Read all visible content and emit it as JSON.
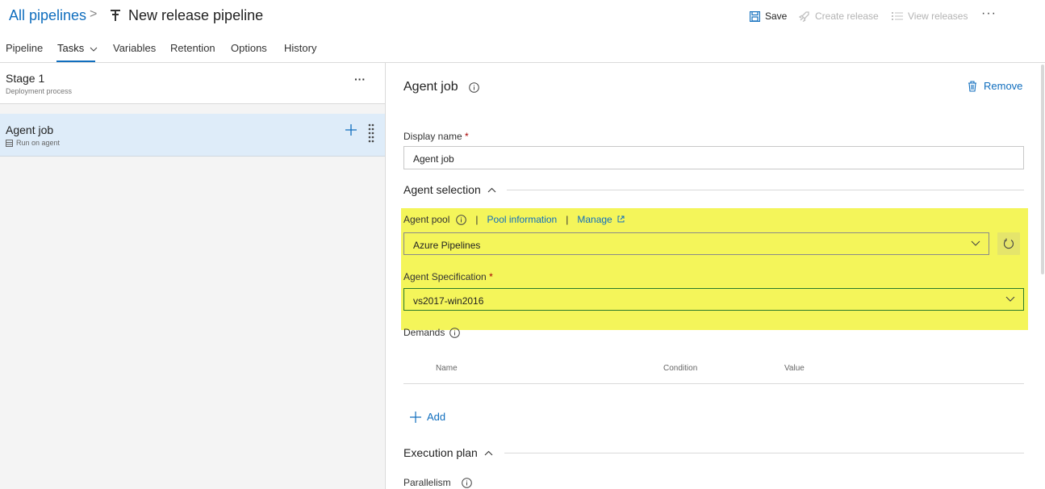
{
  "header": {
    "breadcrumb_root": "All pipelines",
    "breadcrumb_sep": ">",
    "title": "New release pipeline",
    "actions": {
      "save": "Save",
      "create_release": "Create release",
      "view_releases": "View releases",
      "more": "···"
    }
  },
  "tabs": [
    {
      "label": "Pipeline"
    },
    {
      "label": "Tasks",
      "active": true
    },
    {
      "label": "Variables"
    },
    {
      "label": "Retention"
    },
    {
      "label": "Options"
    },
    {
      "label": "History"
    }
  ],
  "left_panel": {
    "stage": {
      "name": "Stage 1",
      "subtitle": "Deployment process",
      "more": "···"
    },
    "job": {
      "name": "Agent job",
      "subtitle": "Run on agent"
    }
  },
  "detail": {
    "title": "Agent job",
    "remove_label": "Remove",
    "display_name_label": "Display name",
    "required_mark": "*",
    "display_name_value": "Agent job",
    "agent_selection_label": "Agent selection",
    "agent_pool_label": "Agent pool",
    "pool_info_link": "Pool information",
    "manage_link": "Manage",
    "link_separator": "|",
    "agent_pool_value": "Azure Pipelines",
    "agent_spec_label": "Agent Specification",
    "agent_spec_value": "vs2017-win2016",
    "demands_label": "Demands",
    "demands_columns": [
      "Name",
      "Condition",
      "Value"
    ],
    "add_label": "Add",
    "execution_plan_label": "Execution plan",
    "parallelism_label": "Parallelism"
  },
  "colors": {
    "accent": "#106ebe",
    "highlight": "#f4f55a",
    "selected_row": "#deecf9"
  }
}
